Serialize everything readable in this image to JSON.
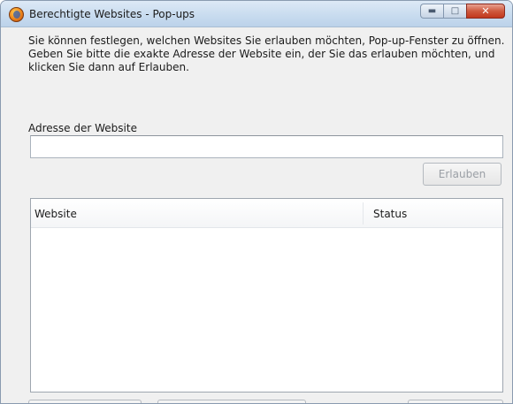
{
  "window": {
    "title": "Berechtigte Websites - Pop-ups",
    "app_icon": "firefox-icon",
    "caption_buttons": {
      "minimize": "minimize-icon",
      "maximize": "maximize-icon",
      "close": "close-icon"
    }
  },
  "description": "Sie können festlegen, welchen Websites Sie erlauben möchten, Pop-up-Fenster zu öffnen. Geben Sie bitte die exakte Adresse der Website ein, der Sie das erlauben möchten, und klicken Sie dann auf Erlauben.",
  "address": {
    "label": "Adresse der Website",
    "value": ""
  },
  "allow_button": {
    "label": "Erlauben",
    "enabled": false
  },
  "list": {
    "columns": [
      "Website",
      "Status"
    ],
    "rows": []
  },
  "colors": {
    "titlebar": "#c9dcef",
    "window_bg": "#f0f0f0",
    "close_button": "#c1381d"
  }
}
